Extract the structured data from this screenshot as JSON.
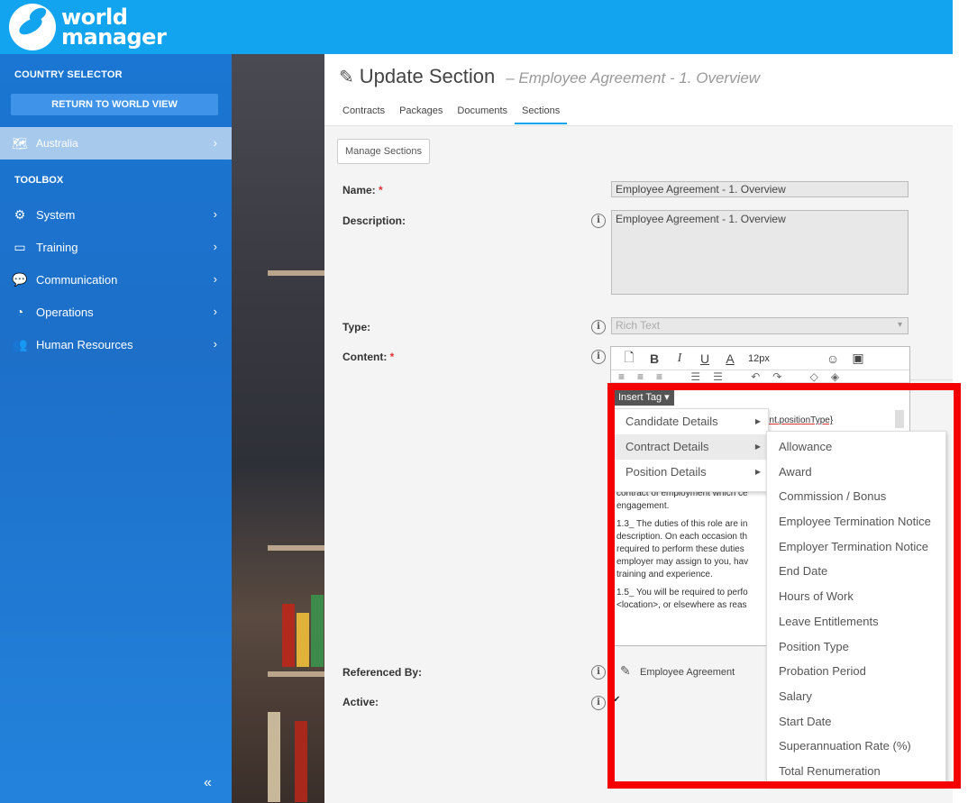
{
  "brand": {
    "line1": "world",
    "line2": "manager"
  },
  "sidebar": {
    "country_selector": "COUNTRY SELECTOR",
    "return_button": "RETURN TO WORLD VIEW",
    "country": "Australia",
    "toolbox": "TOOLBOX",
    "items": [
      {
        "label": "System",
        "icon": "gears-icon"
      },
      {
        "label": "Training",
        "icon": "training-icon"
      },
      {
        "label": "Communication",
        "icon": "chat-icon"
      },
      {
        "label": "Operations",
        "icon": "gauge-icon"
      },
      {
        "label": "Human Resources",
        "icon": "people-icon"
      }
    ],
    "collapse": "«"
  },
  "page": {
    "title": "Update Section",
    "subtitle": "– Employee Agreement - 1. Overview",
    "tabs": [
      "Contracts",
      "Packages",
      "Documents",
      "Sections"
    ],
    "active_tab": "Sections",
    "manage_button": "Manage Sections"
  },
  "form": {
    "name_label": "Name:",
    "name_value": "Employee Agreement - 1. Overview",
    "description_label": "Description:",
    "description_value": "Employee Agreement - 1. Overview",
    "type_label": "Type:",
    "type_value": "Rich Text",
    "content_label": "Content:",
    "referenced_label": "Referenced By:",
    "referenced_value": "Employee Agreement",
    "active_label": "Active:",
    "required_mark": "*"
  },
  "editor": {
    "font_size": "12px",
    "insert_tag": "Insert Tag",
    "partial_tag": "ent.positionType}",
    "paragraphs": [
      "contract of employment which ce engagement.",
      "1.3_ The duties of this role are in description. On each occasion th required to perform these duties employer may assign to you, hav training and experience.",
      "1.5_ You will be required to perfo <location>, or elsewhere as reas"
    ]
  },
  "tag_menu": [
    "Candidate Details",
    "Contract Details",
    "Position Details"
  ],
  "contract_submenu": [
    "Allowance",
    "Award",
    "Commission / Bonus",
    "Employee Termination Notice",
    "Employer Termination Notice",
    "End Date",
    "Hours of Work",
    "Leave Entitlements",
    "Position Type",
    "Probation Period",
    "Salary",
    "Start Date",
    "Superannuation Rate (%)",
    "Total Renumeration"
  ],
  "colors": {
    "topbar": "#12a4ef",
    "sidebar": "#1d6fc8",
    "highlight": "#f40000"
  }
}
